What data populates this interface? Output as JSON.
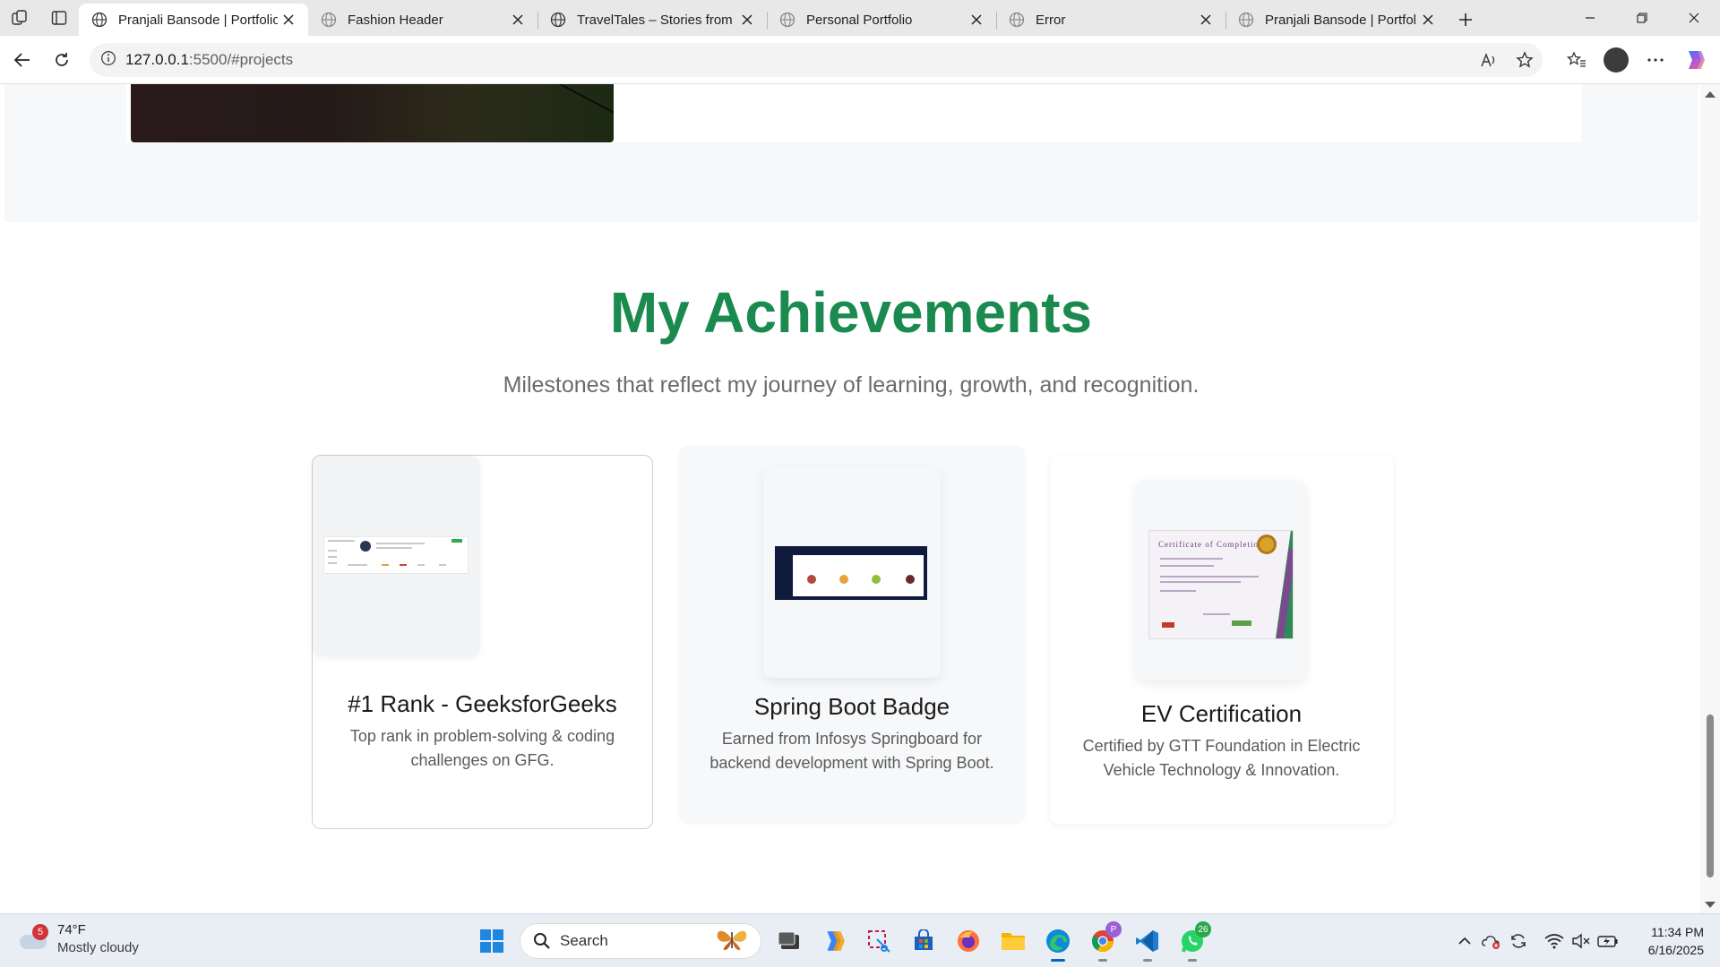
{
  "browser": {
    "tabs": [
      {
        "title": "Pranjali Bansode | Portfolio",
        "active": true
      },
      {
        "title": "Fashion Header",
        "active": false
      },
      {
        "title": "TravelTales – Stories from E",
        "active": false
      },
      {
        "title": "Personal Portfolio",
        "active": false
      },
      {
        "title": "Error",
        "active": false
      },
      {
        "title": "Pranjali Bansode | Portfolio",
        "active": false
      }
    ],
    "url_host": "127.0.0.1",
    "url_rest": ":5500/#projects"
  },
  "page": {
    "achievements": {
      "title": "My Achievements",
      "subtitle": "Milestones that reflect my journey of learning, growth, and recognition.",
      "cards": [
        {
          "title": "#1 Rank - GeeksforGeeks",
          "description": "Top rank in problem-solving & coding challenges on GFG."
        },
        {
          "title": "Spring Boot Badge",
          "description": "Earned from Infosys Springboard for backend development with Spring Boot."
        },
        {
          "title": "EV Certification",
          "description": "Certified by GTT Foundation in Electric Vehicle Technology & Innovation."
        }
      ],
      "certificate_heading": "Certificate of Completion"
    }
  },
  "taskbar": {
    "weather": {
      "temp": "74°F",
      "condition": "Mostly cloudy",
      "badge": "5"
    },
    "search_label": "Search",
    "chrome_badge": "P",
    "whatsapp_badge": "26",
    "time": "11:34 PM",
    "date": "6/16/2025"
  },
  "colors": {
    "accent_green": "#1a8a4f",
    "edge_blue": "#0067c0"
  }
}
